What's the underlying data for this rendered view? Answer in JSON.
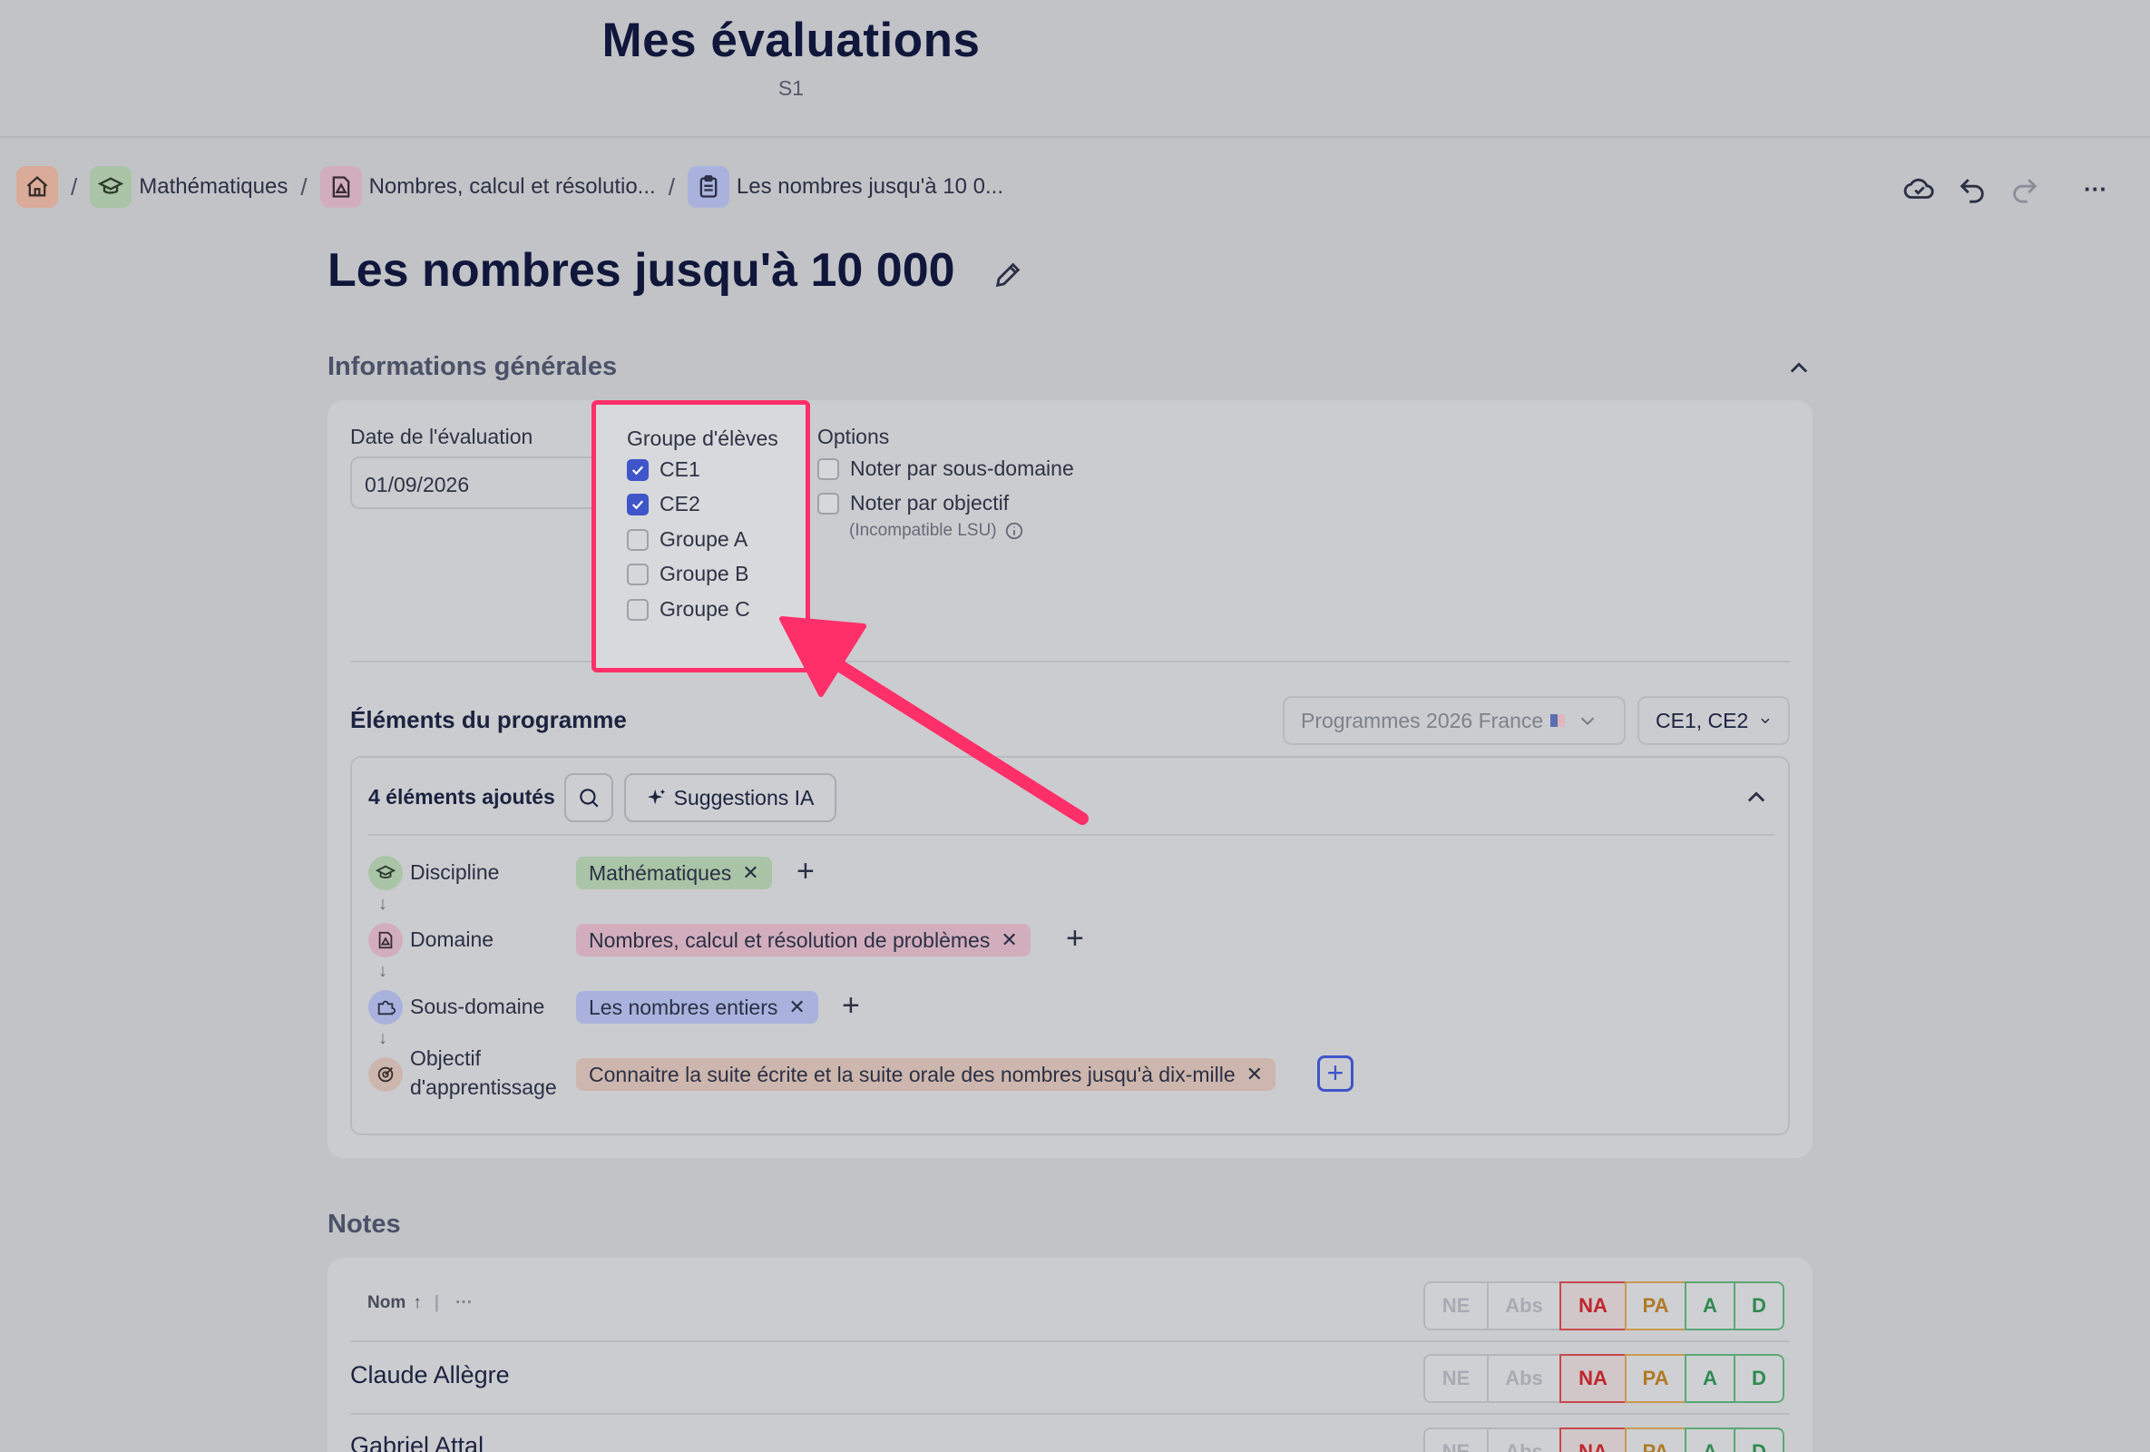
{
  "header": {
    "title": "Mes évaluations",
    "subtitle": "S1"
  },
  "breadcrumb": {
    "items": [
      {
        "label": "",
        "icon": "home-icon"
      },
      {
        "label": "Mathématiques",
        "icon": "graduation-cap-icon"
      },
      {
        "label": "Nombres, calcul et résolutio...",
        "icon": "domain-icon"
      },
      {
        "label": "Les nombres jusqu'à 10 0...",
        "icon": "clipboard-icon"
      }
    ],
    "separator": "/"
  },
  "toolbar": {
    "icons": [
      "cloud-check-icon",
      "undo-icon",
      "redo-icon",
      "more-icon"
    ],
    "more_label": "···"
  },
  "page": {
    "title": "Les nombres jusqu'à 10 000"
  },
  "general": {
    "section_title": "Informations générales",
    "date_label": "Date de l'évaluation",
    "date_value": "01/09/2026",
    "group_label": "Groupe d'élèves",
    "groups": [
      {
        "label": "CE1",
        "checked": true
      },
      {
        "label": "CE2",
        "checked": true
      },
      {
        "label": "Groupe A",
        "checked": false
      },
      {
        "label": "Groupe B",
        "checked": false
      },
      {
        "label": "Groupe C",
        "checked": false
      }
    ],
    "options_label": "Options",
    "options": [
      {
        "label": "Noter par sous-domaine",
        "checked": false
      },
      {
        "label": "Noter par objectif",
        "checked": false,
        "hint": "(Incompatible LSU)"
      }
    ]
  },
  "program": {
    "title": "Éléments du programme",
    "programme_select": "Programmes 2026 France",
    "level_select": "CE1, CE2",
    "added_count_label": "4 éléments ajoutés",
    "ai_button": "Suggestions IA",
    "levels": [
      {
        "label": "Discipline",
        "tag": "Mathématiques",
        "color": "#a9c4a6",
        "icon_bg": "#a9c4a6"
      },
      {
        "label": "Domaine",
        "tag": "Nombres, calcul et résolution de problèmes",
        "color": "#d2aebd",
        "icon_bg": "#d2aebd"
      },
      {
        "label": "Sous-domaine",
        "tag": "Les nombres entiers",
        "color": "#a9b2dd",
        "icon_bg": "#a9b2dd"
      },
      {
        "label": "Objectif d'apprentissage",
        "label_line1": "Objectif",
        "label_line2": "d'apprentissage",
        "tag": "Connaitre la suite écrite et la suite orale des nombres jusqu'à dix-mille",
        "color": "#cdb6ad",
        "icon_bg": "#cdb6ad"
      }
    ],
    "arrow": "↓",
    "remove_glyph": "✕",
    "add_glyph": "+"
  },
  "notes": {
    "title": "Notes",
    "sort_label": "Nom",
    "sort_arrow": "↑",
    "extra": "···",
    "grades": [
      "NE",
      "Abs",
      "NA",
      "PA",
      "A",
      "D"
    ],
    "students": [
      "Claude Allègre",
      "Gabriel Attal"
    ]
  },
  "colors": {
    "highlight": "#ff2f69",
    "check": "#3f55c9",
    "background": "#c2c3c7"
  }
}
